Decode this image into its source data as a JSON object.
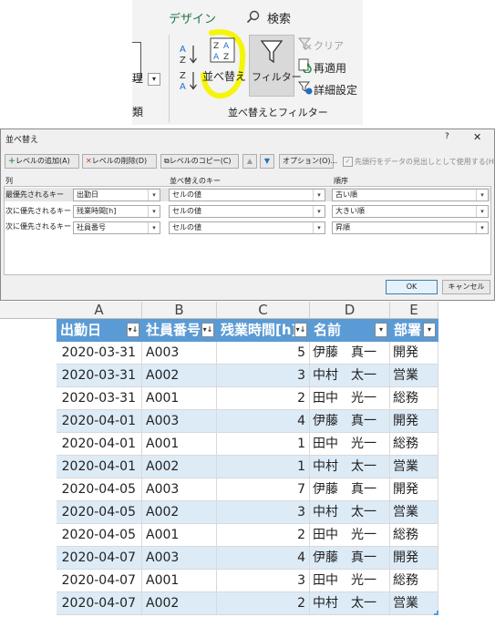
{
  "ribbon": {
    "tab_design": "デザイン",
    "tab_search": "検索",
    "left_partial_label": "理",
    "left_partial_group": "類",
    "sort_label": "並べ替え",
    "sort_az_icon": "sort-ascending-icon",
    "sort_za_icon": "sort-descending-icon",
    "filter_label": "フィルター",
    "clear_label": "クリア",
    "reapply_label": "再適用",
    "advanced_label": "詳細設定",
    "group_label": "並べ替えとフィルター",
    "highlight_color": "#f5f50a"
  },
  "dialog": {
    "title": "並べ替え",
    "help": "?",
    "close": "✕",
    "add_level": "レベルの追加(A)",
    "delete_level": "レベルの削除(D)",
    "copy_level": "レベルのコピー(C)",
    "up": "▲",
    "down": "▼",
    "options": "オプション(O)...",
    "header_checkbox_label": "先頭行をデータの見出しとして使用する(H)",
    "col_header_column": "列",
    "col_header_key": "並べ替えのキー",
    "col_header_order": "順序",
    "levels": [
      {
        "prefix": "最優先されるキー",
        "column": "出勤日",
        "key": "セルの値",
        "order": "古い順"
      },
      {
        "prefix": "次に優先されるキー",
        "column": "残業時間[h]",
        "key": "セルの値",
        "order": "大きい順"
      },
      {
        "prefix": "次に優先されるキー",
        "column": "社員番号",
        "key": "セルの値",
        "order": "昇順"
      }
    ],
    "ok": "OK",
    "cancel": "キャンセル"
  },
  "sheet": {
    "column_letters": [
      "A",
      "B",
      "C",
      "D",
      "E"
    ],
    "headers": [
      "出勤日",
      "社員番号",
      "残業時間[h]",
      "名前",
      "部署"
    ],
    "header_color": "#5b9bd5",
    "band_color": "#ddebf7",
    "rows": [
      [
        "2020-03-31",
        "A003",
        "5",
        "伊藤　真一",
        "開発"
      ],
      [
        "2020-03-31",
        "A002",
        "3",
        "中村　太一",
        "営業"
      ],
      [
        "2020-03-31",
        "A001",
        "2",
        "田中　光一",
        "総務"
      ],
      [
        "2020-04-01",
        "A003",
        "4",
        "伊藤　真一",
        "開発"
      ],
      [
        "2020-04-01",
        "A001",
        "1",
        "田中　光一",
        "総務"
      ],
      [
        "2020-04-01",
        "A002",
        "1",
        "中村　太一",
        "営業"
      ],
      [
        "2020-04-05",
        "A003",
        "7",
        "伊藤　真一",
        "開発"
      ],
      [
        "2020-04-05",
        "A002",
        "3",
        "中村　太一",
        "営業"
      ],
      [
        "2020-04-05",
        "A001",
        "2",
        "田中　光一",
        "総務"
      ],
      [
        "2020-04-07",
        "A003",
        "4",
        "伊藤　真一",
        "開発"
      ],
      [
        "2020-04-07",
        "A001",
        "3",
        "田中　光一",
        "総務"
      ],
      [
        "2020-04-07",
        "A002",
        "2",
        "中村　太一",
        "営業"
      ]
    ]
  }
}
